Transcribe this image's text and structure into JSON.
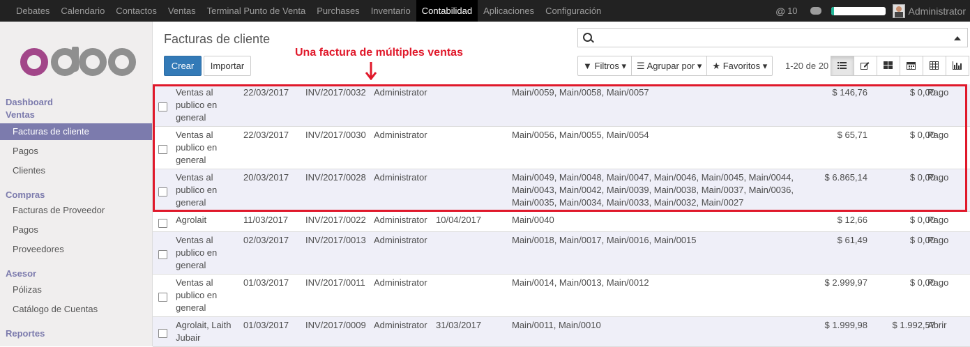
{
  "topbar": {
    "menu": [
      "Debates",
      "Calendario",
      "Contactos",
      "Ventas",
      "Terminal Punto de Venta",
      "Purchases",
      "Inventario",
      "Contabilidad",
      "Aplicaciones",
      "Configuración"
    ],
    "active_menu": "Contabilidad",
    "notification_count": "10",
    "progress_fraction": 0.06,
    "user_name": "Administrator",
    "icons": [
      "at-icon",
      "chat-icon",
      "avatar"
    ],
    "colors": {
      "bar_bg": "#222222",
      "active_bg": "#000000",
      "progress": "#21b799"
    }
  },
  "sidebar": {
    "logo_text": "odoo",
    "sections": [
      {
        "heading": "Dashboard"
      },
      {
        "heading": "Ventas",
        "items": [
          "Facturas de cliente",
          "Pagos",
          "Clientes"
        ]
      },
      {
        "heading": "Compras",
        "items": [
          "Facturas de Proveedor",
          "Pagos",
          "Proveedores"
        ]
      },
      {
        "heading": "Asesor",
        "items": [
          "Pólizas",
          "Catálogo de Cuentas"
        ]
      },
      {
        "heading": "Reportes"
      }
    ],
    "active_item": "Facturas de cliente",
    "colors": {
      "heading": "#7c7bad",
      "active_bg": "#7c7bad"
    }
  },
  "control_panel": {
    "title": "Facturas de cliente",
    "create_label": "Crear",
    "import_label": "Importar",
    "filters_label": "Filtros",
    "group_by_label": "Agrupar por",
    "favorites_label": "Favoritos",
    "pager_text": "1-20 de 20",
    "views": [
      "list-view-icon",
      "edit-view-icon",
      "kanban-view-icon",
      "calendar-view-icon",
      "pivot-view-icon",
      "graph-view-icon"
    ],
    "active_view": "list-view-icon"
  },
  "annotation": {
    "text": "Una factura de múltiples ventas",
    "color": "#e0182a"
  },
  "invoices": [
    {
      "partner": "Ventas al publico en general",
      "date": "22/03/2017",
      "number": "INV/2017/0032",
      "salesperson": "Administrator",
      "due_date": "",
      "origin": "Main/0059, Main/0058, Main/0057",
      "total": "$ 146,76",
      "residual": "$ 0,00",
      "state": "Pago"
    },
    {
      "partner": "Ventas al publico en general",
      "date": "22/03/2017",
      "number": "INV/2017/0030",
      "salesperson": "Administrator",
      "due_date": "",
      "origin": "Main/0056, Main/0055, Main/0054",
      "total": "$ 65,71",
      "residual": "$ 0,00",
      "state": "Pago"
    },
    {
      "partner": "Ventas al publico en general",
      "date": "20/03/2017",
      "number": "INV/2017/0028",
      "salesperson": "Administrator",
      "due_date": "",
      "origin": "Main/0049, Main/0048, Main/0047, Main/0046, Main/0045, Main/0044, Main/0043, Main/0042, Main/0039, Main/0038, Main/0037, Main/0036, Main/0035, Main/0034, Main/0033, Main/0032, Main/0027",
      "total": "$ 6.865,14",
      "residual": "$ 0,00",
      "state": "Pago"
    },
    {
      "partner": "Agrolait",
      "date": "11/03/2017",
      "number": "INV/2017/0022",
      "salesperson": "Administrator",
      "due_date": "10/04/2017",
      "origin": "Main/0040",
      "total": "$ 12,66",
      "residual": "$ 0,00",
      "state": "Pago"
    },
    {
      "partner": "Ventas al publico en general",
      "date": "02/03/2017",
      "number": "INV/2017/0013",
      "salesperson": "Administrator",
      "due_date": "",
      "origin": "Main/0018, Main/0017, Main/0016, Main/0015",
      "total": "$ 61,49",
      "residual": "$ 0,00",
      "state": "Pago"
    },
    {
      "partner": "Ventas al publico en general",
      "date": "01/03/2017",
      "number": "INV/2017/0011",
      "salesperson": "Administrator",
      "due_date": "",
      "origin": "Main/0014, Main/0013, Main/0012",
      "total": "$ 2.999,97",
      "residual": "$ 0,00",
      "state": "Pago"
    },
    {
      "partner": "Agrolait, Laith Jubair",
      "date": "01/03/2017",
      "number": "INV/2017/0009",
      "salesperson": "Administrator",
      "due_date": "31/03/2017",
      "origin": "Main/0011, Main/0010",
      "total": "$ 1.999,98",
      "residual": "$ 1.992,57",
      "state": "Abrir"
    }
  ]
}
